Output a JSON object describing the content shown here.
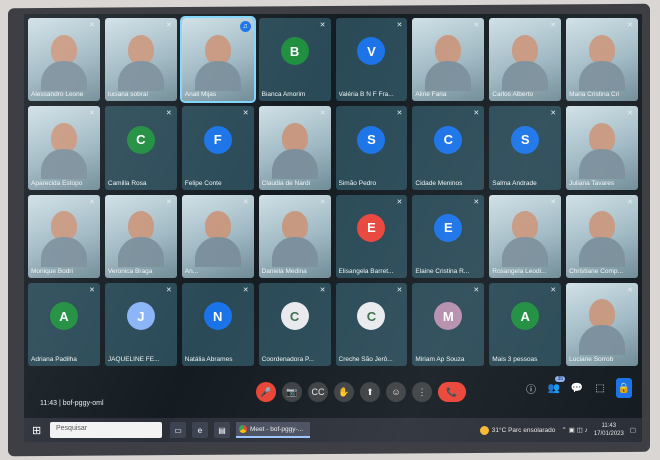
{
  "meeting": {
    "code": "bof-pggy-oml",
    "time": "11:43"
  },
  "participants": [
    {
      "name": "Alessandro Leone",
      "type": "cam"
    },
    {
      "name": "luciana sobral",
      "type": "cam"
    },
    {
      "name": "Anali Mijas",
      "type": "cam",
      "speaking": true
    },
    {
      "name": "Bianca Amorim",
      "type": "avatar",
      "initial": "B",
      "color": "#1e8e3e"
    },
    {
      "name": "Valéria B N F Fra...",
      "type": "avatar",
      "initial": "V",
      "color": "#1a73e8"
    },
    {
      "name": "Aline Faria",
      "type": "cam"
    },
    {
      "name": "Carlos Alberto",
      "type": "cam"
    },
    {
      "name": "Maria Cristina Cri",
      "type": "cam"
    },
    {
      "name": "Aparecida Estopo",
      "type": "cam"
    },
    {
      "name": "Camilla Rosa",
      "type": "avatar",
      "initial": "C",
      "color": "#1e8e3e"
    },
    {
      "name": "Felipe Conte",
      "type": "avatar",
      "initial": "F",
      "color": "#1a73e8"
    },
    {
      "name": "Claudia de Nardi",
      "type": "cam"
    },
    {
      "name": "Simão Pedro",
      "type": "avatar",
      "initial": "S",
      "color": "#1a73e8"
    },
    {
      "name": "Cidade Meninos",
      "type": "avatar",
      "initial": "C",
      "color": "#1a73e8"
    },
    {
      "name": "Salma Andrade",
      "type": "avatar",
      "initial": "S",
      "color": "#1a73e8"
    },
    {
      "name": "Juliana Tavares",
      "type": "cam"
    },
    {
      "name": "Monique Bodri",
      "type": "cam"
    },
    {
      "name": "Veronica Braga",
      "type": "cam"
    },
    {
      "name": "An...",
      "type": "cam"
    },
    {
      "name": "Daniela Medina",
      "type": "cam"
    },
    {
      "name": "Elisangela Barret...",
      "type": "avatar",
      "initial": "E",
      "color": "#e8453c"
    },
    {
      "name": "Elaine Cristina R...",
      "type": "avatar",
      "initial": "E",
      "color": "#1a73e8"
    },
    {
      "name": "Rosangela Leodi...",
      "type": "cam"
    },
    {
      "name": "Christiane Comp...",
      "type": "cam"
    },
    {
      "name": "Adriana Padilha",
      "type": "avatar",
      "initial": "A",
      "color": "#1e8e3e"
    },
    {
      "name": "JAQUELINE FE...",
      "type": "avatar",
      "initial": "J",
      "color": "#8ab4f8"
    },
    {
      "name": "Natália Abrames",
      "type": "avatar",
      "initial": "N",
      "color": "#1a73e8"
    },
    {
      "name": "Coordenadora P...",
      "type": "avatar",
      "initial": "C",
      "color": "#e8eaed"
    },
    {
      "name": "Creche São Jerô...",
      "type": "avatar",
      "initial": "C",
      "color": "#e8eaed"
    },
    {
      "name": "Miriam Ap Souza",
      "type": "avatar",
      "initial": "M",
      "color": "#b48ead"
    },
    {
      "name": "Mais 3 pessoas",
      "type": "avatar",
      "initial": "A",
      "color": "#1e8e3e"
    },
    {
      "name": "Luciane Sorrob",
      "type": "cam"
    }
  ],
  "controls": {
    "mic": "🎤",
    "camera": "📷",
    "captions": "CC",
    "hand": "✋",
    "present": "⬆",
    "emoji": "☺",
    "more": "⋮",
    "end": "📞"
  },
  "right_panel": {
    "info": "ⓘ",
    "people": "👥",
    "people_count": "35",
    "chat": "💬",
    "activities": "⬚",
    "host": "🔒"
  },
  "taskbar": {
    "search_placeholder": "Pesquisar",
    "chrome_tab": "Meet - bof-pggy-...",
    "weather": "31°C  Parc ensolarado",
    "clock_time": "11:43",
    "clock_date": "17/01/2023"
  }
}
